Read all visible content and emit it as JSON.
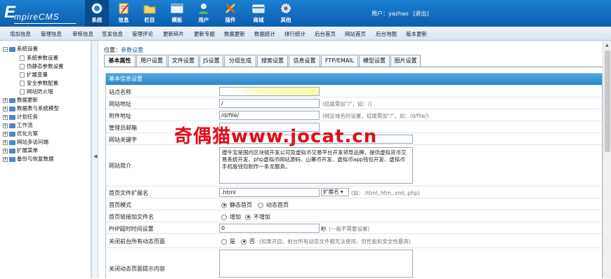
{
  "app": {
    "logo_first": "E",
    "logo_rest": "mpireCMS",
    "user_label": "用户：yazhao",
    "logout": "[退出]"
  },
  "topnav": [
    {
      "label": "系统",
      "icon": "globe-icon"
    },
    {
      "label": "信息",
      "icon": "edit-note-icon"
    },
    {
      "label": "栏目",
      "icon": "folder-icon"
    },
    {
      "label": "模板",
      "icon": "window-template-icon"
    },
    {
      "label": "用户",
      "icon": "user-icon"
    },
    {
      "label": "插件",
      "icon": "tools-icon"
    },
    {
      "label": "商城",
      "icon": "mall-card-icon"
    },
    {
      "label": "其他",
      "icon": "gear-icon"
    }
  ],
  "subnav": [
    "增加信息",
    "管理信息",
    "审核信息",
    "签发信息",
    "管理评论",
    "更新碎片",
    "更新专题",
    "数据更新",
    "数据统计",
    "排行统计",
    "后台首页",
    "网站首页",
    "后台地图",
    "版本更新"
  ],
  "sidebar": {
    "items": [
      {
        "label": "系统设置",
        "kind": "root-open"
      },
      {
        "label": "系统参数设置",
        "kind": "child"
      },
      {
        "label": "伪静态参数设置",
        "kind": "child"
      },
      {
        "label": "扩展变量",
        "kind": "child"
      },
      {
        "label": "安全参数配置",
        "kind": "child"
      },
      {
        "label": "网站防火墙",
        "kind": "child"
      },
      {
        "label": "数据更新",
        "kind": "root"
      },
      {
        "label": "数据表与系统模型",
        "kind": "root"
      },
      {
        "label": "计划任务",
        "kind": "root"
      },
      {
        "label": "工作流",
        "kind": "root"
      },
      {
        "label": "优化方案",
        "kind": "root"
      },
      {
        "label": "网站多访问端",
        "kind": "root"
      },
      {
        "label": "扩展菜单",
        "kind": "root"
      },
      {
        "label": "备份与恢复数据",
        "kind": "root"
      }
    ],
    "splitter_glyph": "◀"
  },
  "main": {
    "position_prefix": "位置：",
    "position_link": "参数设置",
    "tabs": [
      "基本属性",
      "用户设置",
      "文件设置",
      "JS设置",
      "分组生成",
      "搜索设置",
      "信息设置",
      "FTP/EMAIL",
      "模型设置",
      "图片设置"
    ],
    "section_title": "基本信息设置",
    "fields": {
      "site_name": {
        "label": "站点名称",
        "value": ""
      },
      "site_url": {
        "label": "网站地址",
        "value": "/",
        "hint": "(结尾需加\"/\"，如：/)"
      },
      "attach_url": {
        "label": "附件地址",
        "value": "/d/file/",
        "hint": "(绑定域名时设置，结尾需加\"/\"，如：/d/file/)"
      },
      "admin_email": {
        "label": "管理员邮箱",
        "value": ""
      },
      "keywords": {
        "label": "网站关键字",
        "value": ""
      },
      "intro": {
        "label": "网站简介",
        "value": "搜牛宝是国内区块链开发公司及虚拟币交易平台开发领导品牌，提供虚拟货币交易系统开发、php虚拟币网站源码、山寨币开发、虚拟币app钱包开发、虚拟币手机版钱包制作一条龙服务。"
      },
      "index_ext": {
        "label": "首页文件扩展名",
        "value": ".html",
        "select": "扩展名 ▾",
        "hint": "(如：.html,.htm,.xml,.php)"
      },
      "index_mode": {
        "label": "首页模式",
        "options": [
          "静态首页",
          "动态首页"
        ],
        "selected": 0
      },
      "index_link_file": {
        "label": "首页链接加文件名",
        "options": [
          "增加",
          "不增加"
        ],
        "selected": 1
      },
      "php_timeout": {
        "label": "PHP超时时间设置",
        "value": "0",
        "unit": "秒",
        "hint": "(一般不需要设置)"
      },
      "close_dynamic": {
        "label": "关闭前台所有动态页面",
        "options": [
          "是",
          "否"
        ],
        "selected": 1,
        "hint": "(如果开启，前台所有动态文件都无法使用，但性能和安全性最高)"
      },
      "close_tip": {
        "label": "关闭动态页面提示内容",
        "value": ""
      }
    }
  },
  "watermark": "奇偶猫www.jocat.cn"
}
